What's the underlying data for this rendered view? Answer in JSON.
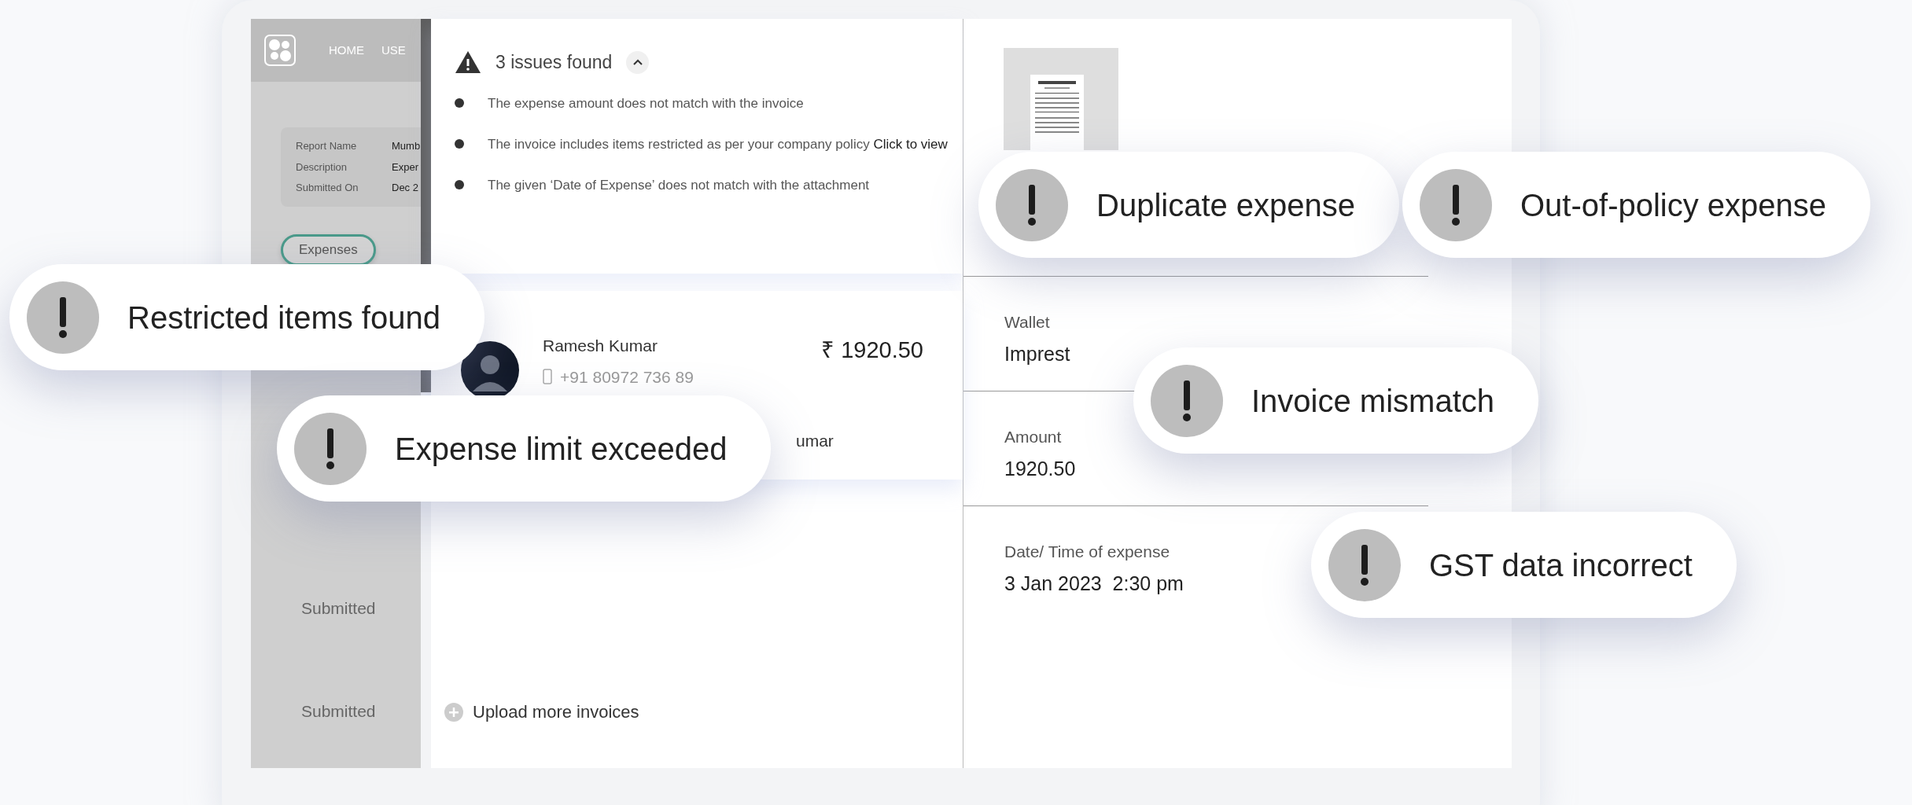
{
  "nav": {
    "items": [
      "HOME",
      "USE"
    ]
  },
  "report_info": [
    {
      "label": "Report Name",
      "value": "Mumb"
    },
    {
      "label": "Description",
      "value": "Exper"
    },
    {
      "label": "Submitted On",
      "value": "Dec 2"
    }
  ],
  "tabs": [
    {
      "label": "Expenses",
      "selected": true
    }
  ],
  "statuses": [
    "Submitted",
    "Submitted"
  ],
  "issues": {
    "title": "3 issues found",
    "expanded": true,
    "items": [
      {
        "text": "The expense amount does not match with the invoice"
      },
      {
        "text": "The invoice includes items restricted as per your company policy",
        "link": "Click to view"
      },
      {
        "text": "The given ‘Date of Expense’ does not match with the attachment"
      }
    ]
  },
  "claimant": {
    "name": "Ramesh Kumar",
    "phone": "+91 80972 736 89",
    "amount": "₹ 1920.50",
    "approver": "umar"
  },
  "upload": {
    "label": "Upload more invoices"
  },
  "details": [
    {
      "label": "Wallet",
      "value": "Imprest"
    },
    {
      "label": "Amount",
      "value": "1920.50"
    },
    {
      "label": "Date/ Time of expense",
      "value": "3 Jan 2023  2:30 pm"
    }
  ],
  "alerts": [
    {
      "label": "Restricted items found"
    },
    {
      "label": "Expense limit exceeded"
    },
    {
      "label": "Duplicate expense"
    },
    {
      "label": "Out-of-policy expense"
    },
    {
      "label": "Invoice mismatch"
    },
    {
      "label": "GST data incorrect"
    }
  ]
}
